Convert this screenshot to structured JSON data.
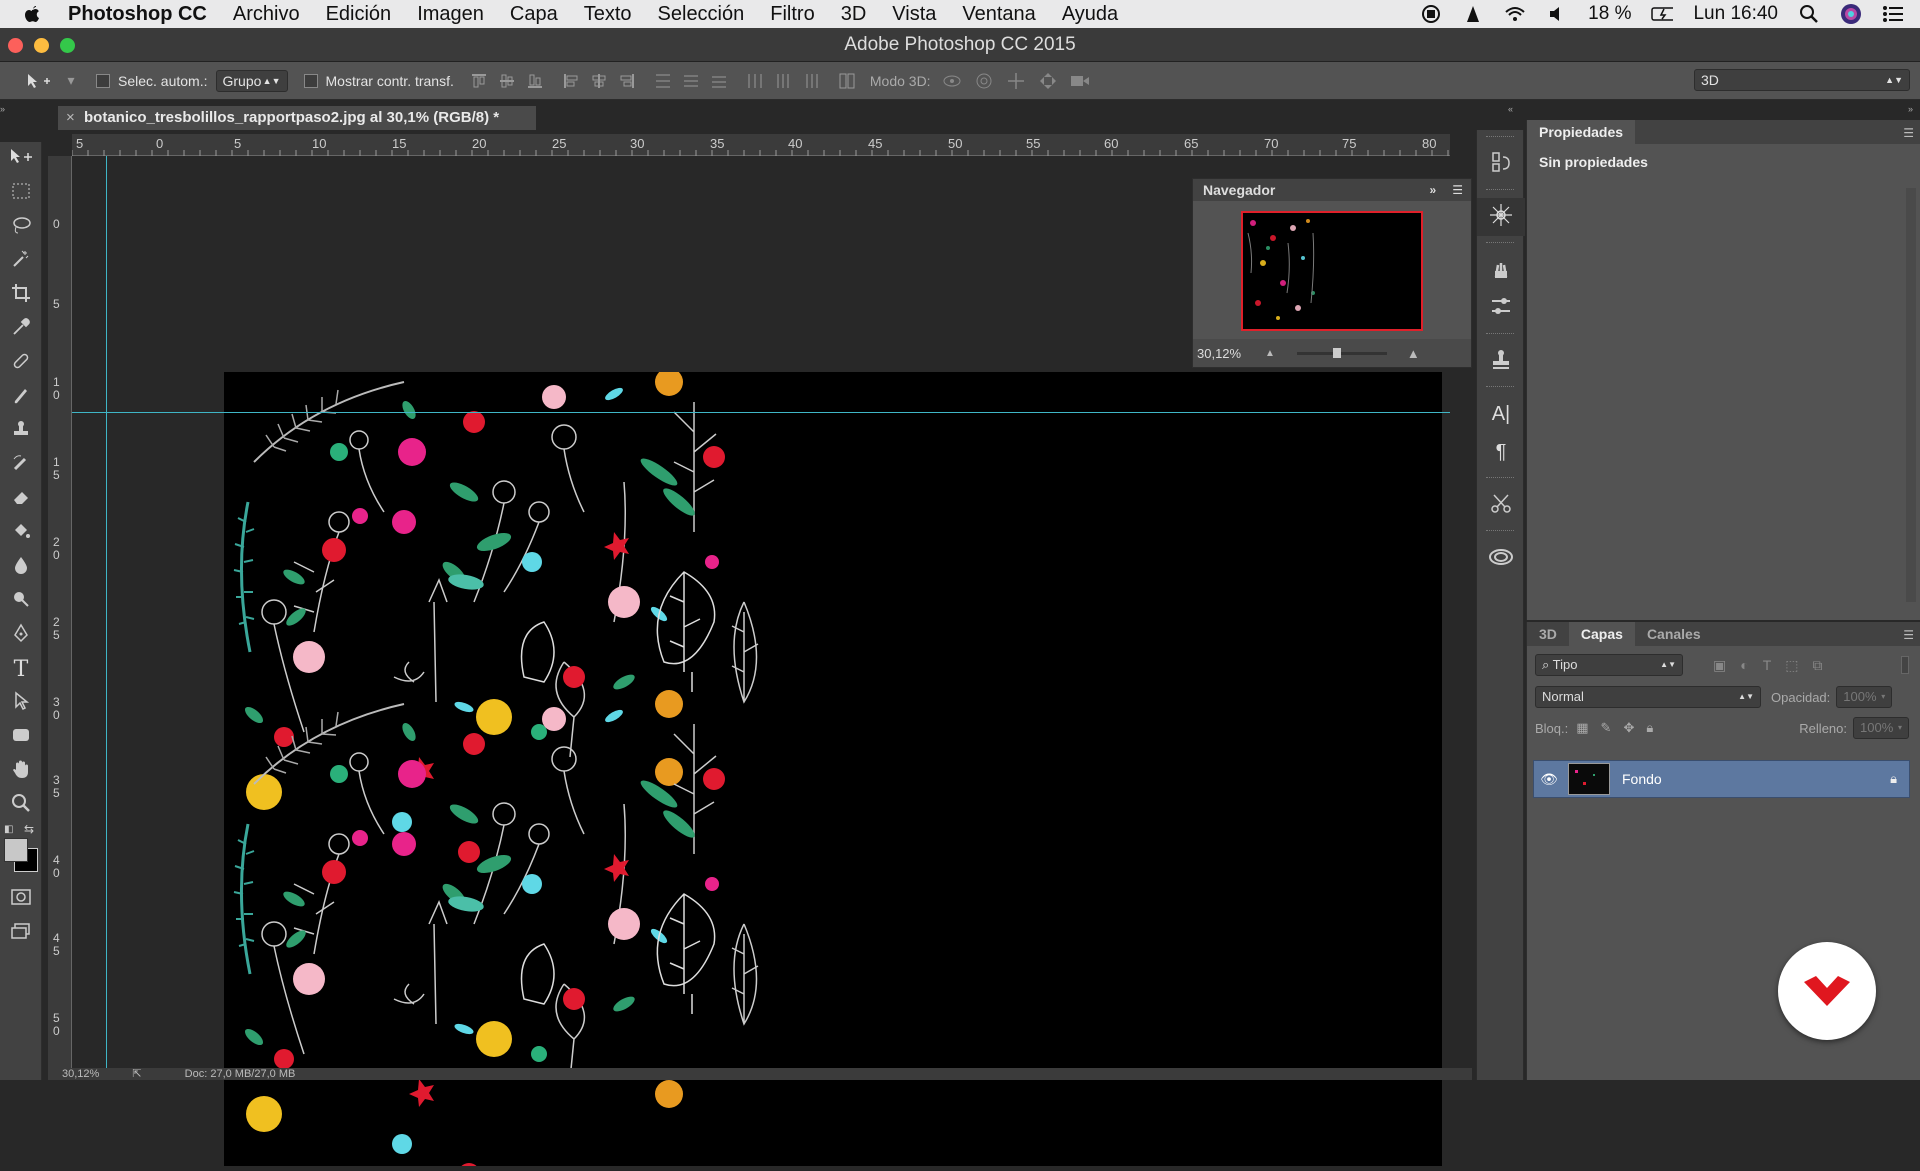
{
  "menubar": {
    "app_name": "Photoshop CC",
    "items": [
      "Archivo",
      "Edición",
      "Imagen",
      "Capa",
      "Texto",
      "Selección",
      "Filtro",
      "3D",
      "Vista",
      "Ventana",
      "Ayuda"
    ],
    "battery": "18 %",
    "clock": "Lun 16:40"
  },
  "window": {
    "title": "Adobe Photoshop CC 2015"
  },
  "options": {
    "auto_select_label": "Selec. autom.:",
    "auto_select_value": "Grupo",
    "show_transform_label": "Mostrar contr. transf.",
    "mode3d_label": "Modo 3D:",
    "workspace_value": "3D"
  },
  "document": {
    "tab_title": "botanico_tresbolillos_rapportpaso2.jpg al 30,1% (RGB/8) *",
    "status_zoom": "30,12%",
    "status_doc": "Doc: 27,0 MB/27,0 MB"
  },
  "rulers": {
    "horizontal": [
      "5",
      "0",
      "5",
      "10",
      "15",
      "20",
      "25",
      "30",
      "35",
      "40",
      "45",
      "50",
      "55",
      "60",
      "65",
      "70",
      "75",
      "80"
    ],
    "vertical": [
      "0",
      "5",
      "10",
      "15",
      "20",
      "25",
      "30",
      "35",
      "40",
      "45",
      "50"
    ]
  },
  "navigator": {
    "title": "Navegador",
    "zoom": "30,12%"
  },
  "properties": {
    "tab": "Propiedades",
    "content": "Sin propiedades"
  },
  "layers": {
    "tabs": [
      "3D",
      "Capas",
      "Canales"
    ],
    "filter_kind": "Tipo",
    "blend_mode": "Normal",
    "opacity_label": "Opacidad:",
    "opacity_value": "100%",
    "lock_label": "Bloq.:",
    "fill_label": "Relleno:",
    "fill_value": "100%",
    "items": [
      {
        "name": "Fondo"
      }
    ]
  },
  "colors": {
    "accent_layer": "#5d78a0",
    "navigator_frame": "#e0202a",
    "guide": "#3fb6c6"
  }
}
